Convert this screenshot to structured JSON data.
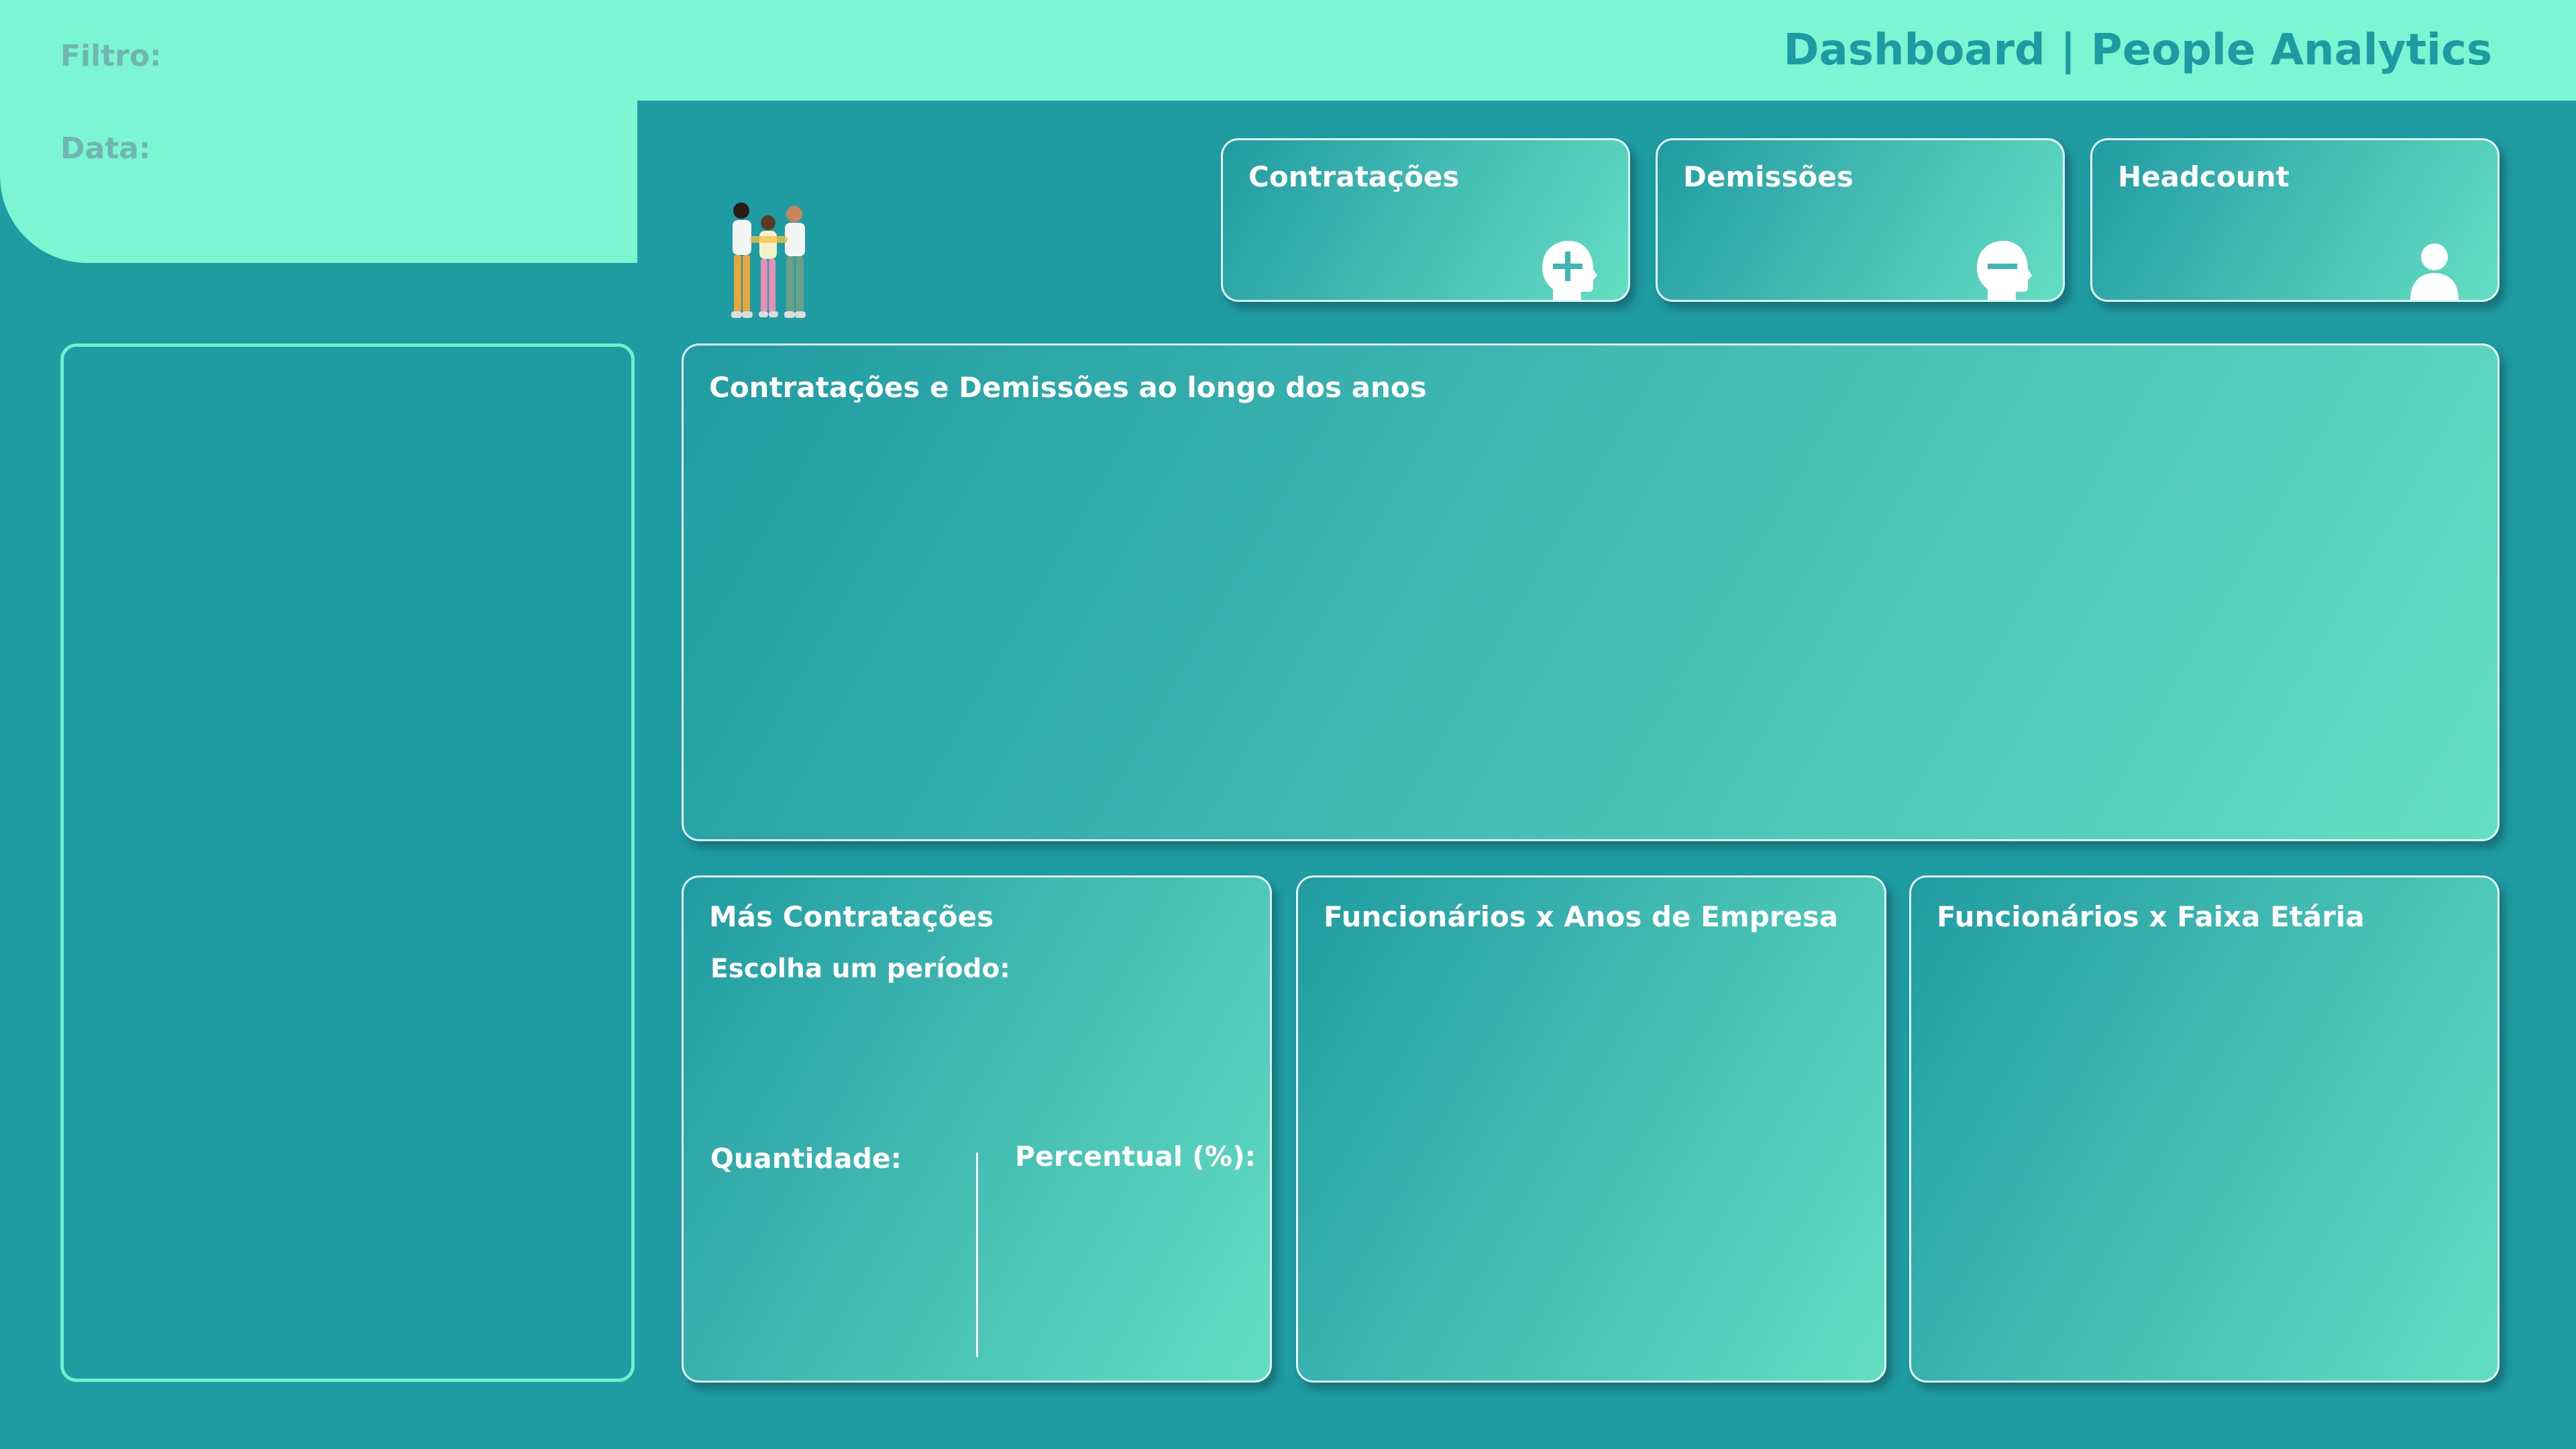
{
  "header": {
    "title": "Dashboard | People Analytics",
    "filter_label": "Filtro:",
    "date_label": "Data:"
  },
  "kpis": [
    {
      "label": "Contratações",
      "icon": "head-plus-icon"
    },
    {
      "label": "Demissões",
      "icon": "head-minus-icon"
    },
    {
      "label": "Headcount",
      "icon": "person-icon"
    }
  ],
  "charts": {
    "hires_fires_title": "Contratações e Demissões ao longo dos anos",
    "bad_hires": {
      "title": "Más Contratações",
      "period_label": "Escolha um período:",
      "quantity_label": "Quantidade:",
      "percent_label": "Percentual (%):"
    },
    "tenure_title": "Funcionários x Anos de Empresa",
    "age_title": "Funcionários x Faixa Etária"
  },
  "colors": {
    "background": "#1f9ba2",
    "accent_light": "#7cf5d2",
    "title_text": "#1e9aa2",
    "card_gradient_start": "#209ca2",
    "card_gradient_end": "#64dec3"
  }
}
